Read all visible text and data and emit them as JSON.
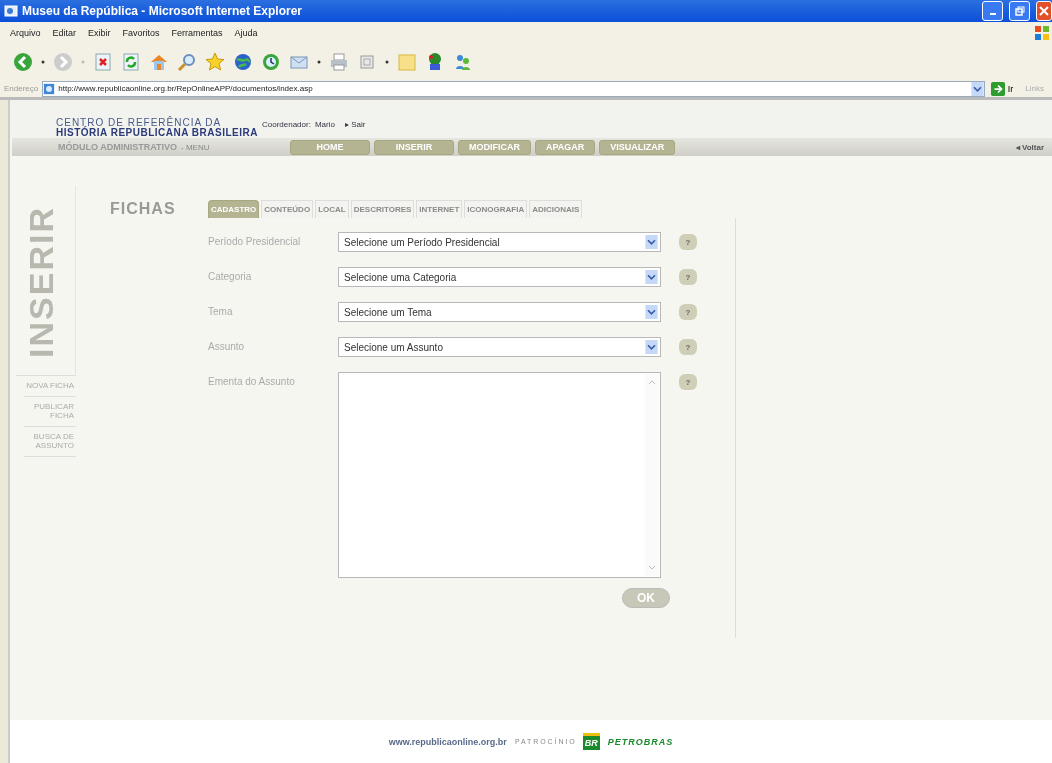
{
  "window": {
    "title": "Museu da República - Microsoft Internet Explorer"
  },
  "menu": [
    "Arquivo",
    "Editar",
    "Exibir",
    "Favoritos",
    "Ferramentas",
    "Ajuda"
  ],
  "address": {
    "label": "Endereço",
    "url": "http://www.republicaonline.org.br/RepOnlineAPP/documentos/index.asp",
    "go": "Ir",
    "links": "Links"
  },
  "site_header": {
    "logo_line_1": "CENTRO DE REFERÊNCIA DA",
    "logo_line_2": "HISTÓRIA REPUBLICANA BRASILEIRA",
    "user_label": "Coordenador:",
    "user_name": "Mario",
    "logout": "▸ Sair"
  },
  "module_bar": {
    "title": "MÓDULO ADMINISTRATIVO",
    "menu_label": "- MENU",
    "back": "◂ Voltar"
  },
  "nav": [
    {
      "label": "HOME",
      "selected": false
    },
    {
      "label": "INSERIR",
      "selected": false
    },
    {
      "label": "MODIFICAR",
      "selected": false
    },
    {
      "label": "APAGAR",
      "selected": false
    },
    {
      "label": "VISUALIZAR",
      "selected": false
    }
  ],
  "sidebar": {
    "section_title": "INSERIR",
    "items": [
      "NOVA FICHA",
      "PUBLICAR FICHA",
      "BUSCA DE ASSUNTO"
    ]
  },
  "page_title": "FICHAS",
  "tabs": [
    {
      "label": "CADASTRO",
      "selected": true
    },
    {
      "label": "CONTEÚDO",
      "selected": false
    },
    {
      "label": "LOCAL",
      "selected": false
    },
    {
      "label": "DESCRITORES",
      "selected": false
    },
    {
      "label": "INTERNET",
      "selected": false
    },
    {
      "label": "ICONOGRAFIA",
      "selected": false
    },
    {
      "label": "ADICIONAIS",
      "selected": false
    }
  ],
  "form": {
    "fields": [
      {
        "kind": "select",
        "label": "Período Presidencial",
        "value": "Selecione um Período Presidencial"
      },
      {
        "kind": "select",
        "label": "Categoria",
        "value": "Selecione uma Categoria"
      },
      {
        "kind": "select",
        "label": "Tema",
        "value": "Selecione um Tema"
      },
      {
        "kind": "select",
        "label": "Assunto",
        "value": "Selecione um Assunto"
      },
      {
        "kind": "textarea",
        "label": "Ementa do Assunto"
      }
    ],
    "help": "?",
    "submit": "OK"
  },
  "footer": {
    "url": "www.republicaonline.org.br",
    "sponsor_label": "P A T R O C Í N I O",
    "sponsor": "PETROBRAS",
    "sponsor_mark": "BR"
  }
}
